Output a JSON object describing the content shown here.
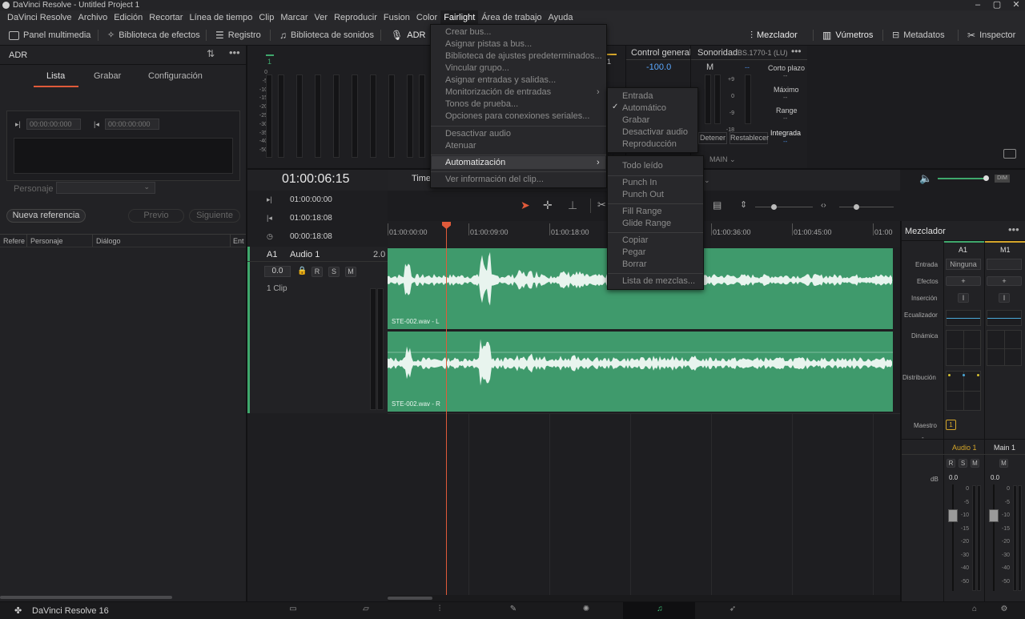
{
  "window": {
    "title": "DaVinci Resolve - Untitled Project 1"
  },
  "menubar": [
    "DaVinci Resolve",
    "Archivo",
    "Edición",
    "Recortar",
    "Línea de tiempo",
    "Clip",
    "Marcar",
    "Ver",
    "Reproducir",
    "Fusion",
    "Color",
    "Fairlight",
    "Área de trabajo",
    "Ayuda"
  ],
  "toolbar": {
    "media": "Panel multimedia",
    "effects": "Biblioteca de efectos",
    "log": "Registro",
    "sounds": "Biblioteca de sonidos",
    "adr": "ADR",
    "mixer": "Mezclador",
    "meters": "Vúmetros",
    "metadata": "Metadatos",
    "inspector": "Inspector"
  },
  "adr": {
    "title": "ADR",
    "tabs": [
      "Lista",
      "Grabar",
      "Configuración"
    ],
    "tc_in": "00:00:00:000",
    "tc_out": "00:00:00:000",
    "character_label": "Personaje",
    "new_ref": "Nueva referencia",
    "prev": "Previo",
    "next": "Siguiente",
    "cols": [
      "Refere",
      "Personaje",
      "Diálogo",
      "Ent"
    ]
  },
  "monitor": {
    "scale": [
      "0",
      "-5",
      "-10",
      "-15",
      "-20",
      "-25",
      "-30",
      "-35",
      "-40",
      "-50"
    ],
    "ch1": "1"
  },
  "control": {
    "title": "Control general",
    "value": "-100.0"
  },
  "loudness": {
    "title": "Sonoridad",
    "standard": "BS.1770-1 (LU)",
    "m": "M",
    "short": "Corto plazo",
    "max": "Máximo",
    "range": "Range",
    "integrated": "Integrada",
    "dash": "--",
    "stop": "Detener",
    "reset": "Restablecer",
    "main": "MAIN",
    "scale": [
      "+9",
      "0",
      "-9",
      "-18"
    ]
  },
  "timeline": {
    "timecode": "01:00:06:15",
    "time_label": "Time",
    "start": "01:00:00:00",
    "end": "01:00:18:08",
    "duration": "00:00:18:08",
    "track_id": "A1",
    "track_name": "Audio 1",
    "track_val": "2.0",
    "vol": "0.0",
    "rsm": [
      "R",
      "S",
      "M"
    ],
    "clips_count": "1 Clip",
    "ruler": [
      "01:00:00:00",
      "01:00:09:00",
      "01:00:18:00",
      "01:00:36:00",
      "01:00:45:00",
      "01:00"
    ],
    "clip_l": "STE-002.wav - L",
    "clip_r": "STE-002.wav - R"
  },
  "mixer": {
    "title": "Mezclador",
    "ch_a1": "A1",
    "ch_m1": "M1",
    "input": "Entrada",
    "input_val": "Ninguna",
    "effects": "Efectos",
    "insert": "Inserción",
    "eq": "Ecualizador",
    "dyn": "Dinámica",
    "dist": "Distribución",
    "master": "Maestro",
    "master_val": "1",
    "name_a1": "Audio 1",
    "name_m1": "Main 1",
    "db": "dB",
    "fader_val": "0.0",
    "scale": [
      "0",
      "-5",
      "-10",
      "-15",
      "-20",
      "-30",
      "-40",
      "-50"
    ],
    "colors": {
      "a1": "#3fa86c",
      "m1": "#d4a52a"
    }
  },
  "fairlight_menu": {
    "items": [
      "Crear bus...",
      "Asignar pistas a bus...",
      "Biblioteca de ajustes predeterminados...",
      "Vincular grupo...",
      "Asignar entradas y salidas...",
      "Monitorización de entradas",
      "Tonos de prueba...",
      "Opciones para conexiones seriales...",
      "Desactivar audio",
      "Atenuar",
      "Automatización",
      "Ver información del clip..."
    ]
  },
  "submenu1": {
    "items": [
      "Entrada",
      "Automático",
      "Grabar",
      "Desactivar audio",
      "Reproducción"
    ]
  },
  "submenu2": {
    "items": [
      "Todo leído",
      "Punch In",
      "Punch Out",
      "Fill Range",
      "Glide Range",
      "Copiar",
      "Pegar",
      "Borrar",
      "Lista de mezclas..."
    ]
  },
  "footer": {
    "app": "DaVinci Resolve 16"
  }
}
